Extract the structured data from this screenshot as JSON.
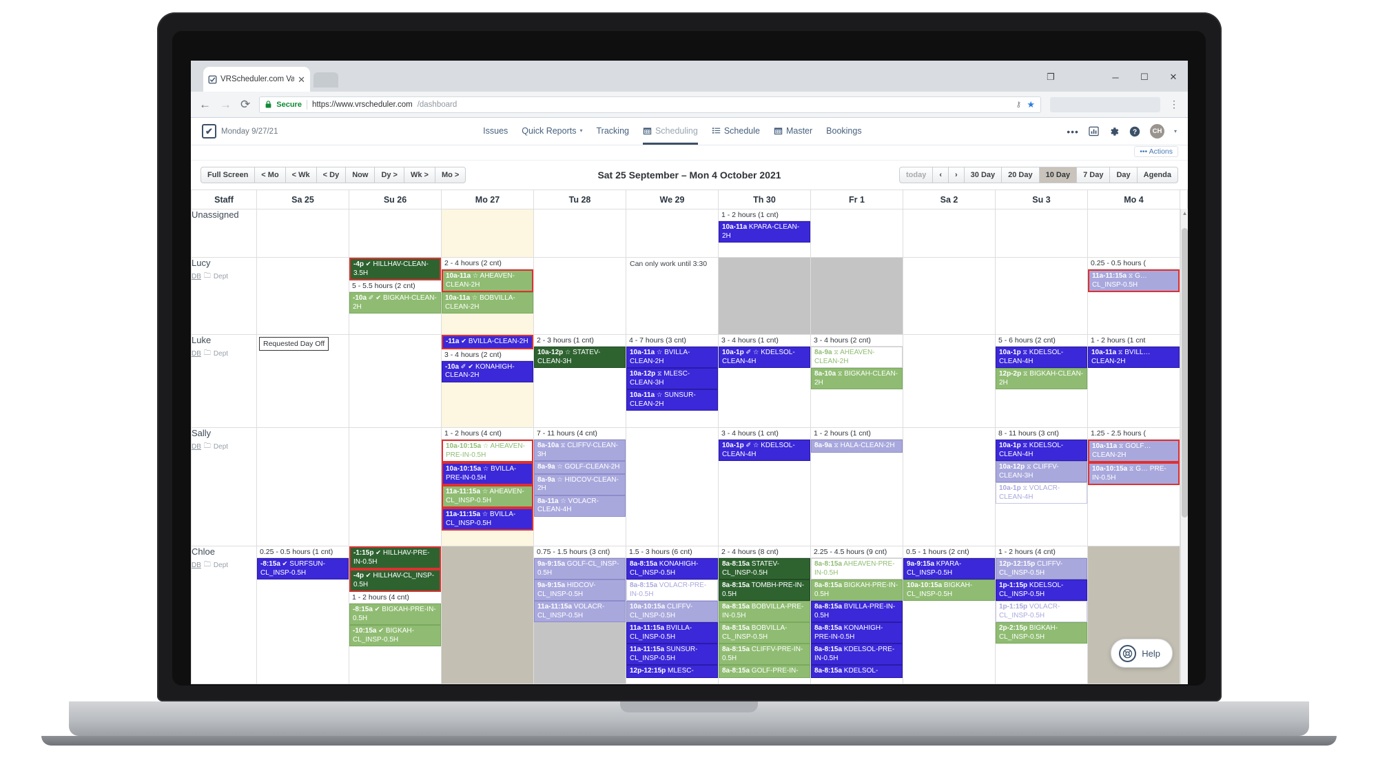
{
  "browser": {
    "tab_title": "VRScheduler.com Vacatio",
    "tab_close": "✕",
    "back": "←",
    "forward": "→",
    "reload": "⟳",
    "secure_label": "Secure",
    "lock_icon": "🔒",
    "url_host": "https://www.vrscheduler.com",
    "url_path": "/dashboard",
    "key_icon": "⚷",
    "star_icon": "★",
    "menu_icon": "⋮",
    "window_minimize": "─",
    "window_maximize": "☐",
    "window_close": "✕",
    "window_restore": "❐"
  },
  "header": {
    "brand_glyph": "✔",
    "brand_date": "Monday  9/27/21",
    "nav": [
      {
        "label": "Issues",
        "icon": "",
        "active": false,
        "caret": false
      },
      {
        "label": "Quick Reports",
        "icon": "",
        "active": false,
        "caret": true
      },
      {
        "label": "Tracking",
        "icon": "",
        "active": false,
        "caret": false
      },
      {
        "label": "Scheduling",
        "icon": "calendar-icon",
        "active": true,
        "caret": false
      },
      {
        "label": "Schedule",
        "icon": "list-icon",
        "active": false,
        "caret": false
      },
      {
        "label": "Master",
        "icon": "calendar-icon",
        "active": false,
        "caret": false
      },
      {
        "label": "Bookings",
        "icon": "",
        "active": false,
        "caret": false
      }
    ],
    "icons": [
      {
        "name": "more-icon",
        "glyph": "•••"
      },
      {
        "name": "chart-icon",
        "glyph": "📊"
      },
      {
        "name": "gear-icon",
        "glyph": "⚙"
      },
      {
        "name": "help-icon",
        "glyph": "?"
      }
    ],
    "avatar_initials": "CH",
    "avatar_caret": "ˇ"
  },
  "actions": {
    "label": "Actions",
    "icon": "•••"
  },
  "toolbar": {
    "left_buttons": [
      "Full Screen",
      "< Mo",
      "< Wk",
      "< Dy",
      "Now",
      "Dy >",
      "Wk >",
      "Mo >"
    ],
    "range_title": "Sat 25 September – Mon 4 October 2021",
    "right_buttons": [
      {
        "label": "today",
        "state": "muted"
      },
      {
        "label": "‹",
        "state": "normal"
      },
      {
        "label": "›",
        "state": "normal"
      },
      {
        "label": "30 Day",
        "state": "normal"
      },
      {
        "label": "20 Day",
        "state": "normal"
      },
      {
        "label": "10 Day",
        "state": "active"
      },
      {
        "label": "7 Day",
        "state": "normal"
      },
      {
        "label": "Day",
        "state": "normal"
      },
      {
        "label": "Agenda",
        "state": "normal"
      }
    ]
  },
  "calendar": {
    "staff_header": "Staff",
    "days": [
      "Sa 25",
      "Su 26",
      "Mo 27",
      "Tu 28",
      "We 29",
      "Th 30",
      "Fr 1",
      "Sa 2",
      "Su 3",
      "Mo 4"
    ],
    "today_index": 2,
    "dept_label": "Dept",
    "db_label": "DB",
    "rows": [
      {
        "staff": "Unassigned",
        "show_meta": false,
        "cells": [
          {},
          {},
          {
            "today": true
          },
          {},
          {},
          {
            "header": "1 - 2 hours (1 cnt)",
            "events": [
              {
                "time": "10a-11a",
                "glyph": "",
                "title": "KPARA-CLEAN-2H",
                "style": "ev-blue"
              }
            ]
          },
          {},
          {},
          {},
          {}
        ]
      },
      {
        "staff": "Lucy",
        "show_meta": true,
        "cells": [
          {},
          {
            "header": "",
            "events": [
              {
                "time": "-4p",
                "glyph": "✔",
                "title": "HILLHAV-CLEAN-3.5H",
                "style": "ev-dgreen",
                "selected": true
              }
            ],
            "header2": "5 - 5.5 hours (2 cnt)",
            "events2": [
              {
                "time": "-10a",
                "glyph": "✐ ✔",
                "title": "BIGKAH-CLEAN-2H",
                "style": "ev-green"
              }
            ]
          },
          {
            "today": true,
            "header": "2 - 4 hours (2 cnt)",
            "events": [
              {
                "time": "10a-11a",
                "glyph": "☆",
                "title": "AHEAVEN-CLEAN-2H",
                "style": "ev-green",
                "selected": true
              },
              {
                "time": "10a-11a",
                "glyph": "☆",
                "title": "BOBVILLA-CLEAN-2H",
                "style": "ev-green"
              }
            ]
          },
          {},
          {
            "note_plain": "Can only work until 3:30"
          },
          {
            "blocked": true
          },
          {
            "blocked": true
          },
          {},
          {},
          {
            "header": "0.25 - 0.5 hours (",
            "events": [
              {
                "time": "11a-11:15a",
                "glyph": "⧖",
                "title": "G… CL_INSP-0.5H",
                "style": "ev-lblue",
                "selected": true
              }
            ]
          }
        ]
      },
      {
        "staff": "Luke",
        "show_meta": true,
        "cells": [
          {
            "note_box": "Requested Day Off"
          },
          {},
          {
            "today": true,
            "events": [
              {
                "time": "-11a",
                "glyph": "✔",
                "title": "BVILLA-CLEAN-2H",
                "style": "ev-blue",
                "selected": true
              }
            ],
            "header2": "3 - 4 hours (2 cnt)",
            "events2": [
              {
                "time": "-10a",
                "glyph": "✐ ✔",
                "title": "KONAHIGH-CLEAN-2H",
                "style": "ev-blue"
              }
            ]
          },
          {
            "header": "2 - 3 hours (1 cnt)",
            "events": [
              {
                "time": "10a-12p",
                "glyph": "☆",
                "title": "STATEV-CLEAN-3H",
                "style": "ev-dgreen"
              }
            ]
          },
          {
            "header": "4 - 7 hours (3 cnt)",
            "events": [
              {
                "time": "10a-11a",
                "glyph": "☆",
                "title": "BVILLA-CLEAN-2H",
                "style": "ev-blue"
              },
              {
                "time": "10a-12p",
                "glyph": "⧖",
                "title": "MLESC-CLEAN-3H",
                "style": "ev-blue"
              },
              {
                "time": "10a-11a",
                "glyph": "☆",
                "title": "SUNSUR-CLEAN-2H",
                "style": "ev-blue"
              }
            ]
          },
          {
            "header": "3 - 4 hours (1 cnt)",
            "events": [
              {
                "time": "10a-1p",
                "glyph": "✐ ☆",
                "title": "KDELSOL-CLEAN-4H",
                "style": "ev-blue"
              }
            ]
          },
          {
            "header": "3 - 4 hours (2 cnt)",
            "events": [
              {
                "time": "8a-9a",
                "glyph": "⧖",
                "title": "AHEAVEN-CLEAN-2H",
                "style": "ev-white-g"
              },
              {
                "time": "8a-10a",
                "glyph": "⧖",
                "title": "BIGKAH-CLEAN-2H",
                "style": "ev-green"
              }
            ]
          },
          {},
          {
            "header": "5 - 6 hours (2 cnt)",
            "events": [
              {
                "time": "10a-1p",
                "glyph": "⧖",
                "title": "KDELSOL-CLEAN-4H",
                "style": "ev-blue"
              },
              {
                "time": "12p-2p",
                "glyph": "⧖",
                "title": "BIGKAH-CLEAN-2H",
                "style": "ev-green"
              }
            ]
          },
          {
            "header": "1 - 2 hours (1 cnt",
            "events": [
              {
                "time": "10a-11a",
                "glyph": "⧖",
                "title": "BVILL… CLEAN-2H",
                "style": "ev-blue"
              }
            ]
          }
        ]
      },
      {
        "staff": "Sally",
        "show_meta": true,
        "cells": [
          {},
          {},
          {
            "today": true,
            "header": "1 - 2 hours (4 cnt)",
            "events": [
              {
                "time": "10a-10:15a",
                "glyph": "☆",
                "title": "AHEAVEN-PRE-IN-0.5H",
                "style": "ev-white-g",
                "selected": true
              },
              {
                "time": "10a-10:15a",
                "glyph": "☆",
                "title": "BVILLA-PRE-IN-0.5H",
                "style": "ev-blue",
                "selected": true
              },
              {
                "time": "11a-11:15a",
                "glyph": "☆",
                "title": "AHEAVEN-CL_INSP-0.5H",
                "style": "ev-green",
                "selected": true
              },
              {
                "time": "11a-11:15a",
                "glyph": "☆",
                "title": "BVILLA-CL_INSP-0.5H",
                "style": "ev-blue",
                "selected": true
              }
            ]
          },
          {
            "header": "7 - 11 hours (4 cnt)",
            "events": [
              {
                "time": "8a-10a",
                "glyph": "⧖",
                "title": "CLIFFV-CLEAN-3H",
                "style": "ev-lblue"
              },
              {
                "time": "8a-9a",
                "glyph": "☆",
                "title": "GOLF-CLEAN-2H",
                "style": "ev-lblue"
              },
              {
                "time": "8a-9a",
                "glyph": "☆",
                "title": "HIDCOV-CLEAN-2H",
                "style": "ev-lblue"
              },
              {
                "time": "8a-11a",
                "glyph": "☆",
                "title": "VOLACR-CLEAN-4H",
                "style": "ev-lblue"
              }
            ]
          },
          {},
          {
            "header": "3 - 4 hours (1 cnt)",
            "events": [
              {
                "time": "10a-1p",
                "glyph": "✐ ☆",
                "title": "KDELSOL-CLEAN-4H",
                "style": "ev-blue"
              }
            ]
          },
          {
            "header": "1 - 2 hours (1 cnt)",
            "events": [
              {
                "time": "8a-9a",
                "glyph": "⧖",
                "title": "HALA-CLEAN-2H",
                "style": "ev-lblue"
              }
            ]
          },
          {},
          {
            "header": "8 - 11 hours (3 cnt)",
            "events": [
              {
                "time": "10a-1p",
                "glyph": "⧖",
                "title": "KDELSOL-CLEAN-4H",
                "style": "ev-blue"
              },
              {
                "time": "10a-12p",
                "glyph": "⧖",
                "title": "CLIFFV-CLEAN-3H",
                "style": "ev-lblue"
              },
              {
                "time": "10a-1p",
                "glyph": "⧖",
                "title": "VOLACR-CLEAN-4H",
                "style": "ev-white-b"
              }
            ]
          },
          {
            "header": "1.25 - 2.5 hours (",
            "events": [
              {
                "time": "10a-11a",
                "glyph": "⧖",
                "title": "GOLF… CLEAN-2H",
                "style": "ev-lblue",
                "selected": true
              },
              {
                "time": "10a-10:15a",
                "glyph": "⧖",
                "title": "G… PRE-IN-0.5H",
                "style": "ev-lblue",
                "selected": true
              }
            ]
          }
        ]
      },
      {
        "staff": "Chloe",
        "show_meta": true,
        "cells": [
          {
            "header": "0.25 - 0.5 hours (1 cnt)",
            "events": [
              {
                "time": "-8:15a",
                "glyph": "✔",
                "title": "SURFSUN-CL_INSP-0.5H",
                "style": "ev-blue"
              }
            ]
          },
          {
            "events": [
              {
                "time": "-1:15p",
                "glyph": "✔",
                "title": "HILLHAV-PRE-IN-0.5H",
                "style": "ev-dgreen",
                "selected": true
              },
              {
                "time": "-4p",
                "glyph": "✔",
                "title": "HILLHAV-CL_INSP-0.5H",
                "style": "ev-dgreen",
                "selected": true
              }
            ],
            "header2": "1 - 2 hours (4 cnt)",
            "events2": [
              {
                "time": "-8:15a",
                "glyph": "✔",
                "title": "BIGKAH-PRE-IN-0.5H",
                "style": "ev-green"
              },
              {
                "time": "-10:15a",
                "glyph": "✔",
                "title": "BIGKAH-CL_INSP-0.5H",
                "style": "ev-green"
              }
            ]
          },
          {
            "today": true,
            "blocked2": true
          },
          {
            "header": "0.75 - 1.5 hours (3 cnt)",
            "blocked": true,
            "events": [
              {
                "time": "9a-9:15a",
                "glyph": "",
                "title": "GOLF-CL_INSP-0.5H",
                "style": "ev-lblue"
              },
              {
                "time": "9a-9:15a",
                "glyph": "",
                "title": "HIDCOV-CL_INSP-0.5H",
                "style": "ev-lblue"
              },
              {
                "time": "11a-11:15a",
                "glyph": "",
                "title": "VOLACR-CL_INSP-0.5H",
                "style": "ev-lblue"
              }
            ]
          },
          {
            "header": "1.5 - 3 hours (6 cnt)",
            "events": [
              {
                "time": "8a-8:15a",
                "glyph": "",
                "title": "KONAHIGH-CL_INSP-0.5H",
                "style": "ev-blue"
              },
              {
                "time": "8a-8:15a",
                "glyph": "",
                "title": "VOLACR-PRE-IN-0.5H",
                "style": "ev-white-b"
              },
              {
                "time": "10a-10:15a",
                "glyph": "",
                "title": "CLIFFV-CL_INSP-0.5H",
                "style": "ev-lblue"
              },
              {
                "time": "11a-11:15a",
                "glyph": "",
                "title": "BVILLA-CL_INSP-0.5H",
                "style": "ev-blue"
              },
              {
                "time": "11a-11:15a",
                "glyph": "",
                "title": "SUNSUR-CL_INSP-0.5H",
                "style": "ev-blue"
              },
              {
                "time": "12p-12:15p",
                "glyph": "",
                "title": "MLESC-",
                "style": "ev-blue"
              }
            ]
          },
          {
            "header": "2 - 4 hours (8 cnt)",
            "events": [
              {
                "time": "8a-8:15a",
                "glyph": "",
                "title": "STATEV-CL_INSP-0.5H",
                "style": "ev-dgreen"
              },
              {
                "time": "8a-8:15a",
                "glyph": "",
                "title": "TOMBH-PRE-IN-0.5H",
                "style": "ev-dgreen"
              },
              {
                "time": "8a-8:15a",
                "glyph": "",
                "title": "BOBVILLA-PRE-IN-0.5H",
                "style": "ev-green"
              },
              {
                "time": "8a-8:15a",
                "glyph": "",
                "title": "BOBVILLA-CL_INSP-0.5H",
                "style": "ev-green"
              },
              {
                "time": "8a-8:15a",
                "glyph": "",
                "title": "CLIFFV-PRE-IN-0.5H",
                "style": "ev-green"
              },
              {
                "time": "8a-8:15a",
                "glyph": "",
                "title": "GOLF-PRE-IN-",
                "style": "ev-green"
              }
            ]
          },
          {
            "header": "2.25 - 4.5 hours (9 cnt)",
            "events": [
              {
                "time": "8a-8:15a",
                "glyph": "",
                "title": "AHEAVEN-PRE-IN-0.5H",
                "style": "ev-white-g"
              },
              {
                "time": "8a-8:15a",
                "glyph": "",
                "title": "BIGKAH-PRE-IN-0.5H",
                "style": "ev-green"
              },
              {
                "time": "8a-8:15a",
                "glyph": "",
                "title": "BVILLA-PRE-IN-0.5H",
                "style": "ev-blue"
              },
              {
                "time": "8a-8:15a",
                "glyph": "",
                "title": "KONAHIGH-PRE-IN-0.5H",
                "style": "ev-blue"
              },
              {
                "time": "8a-8:15a",
                "glyph": "",
                "title": "KDELSOL-PRE-IN-0.5H",
                "style": "ev-blue"
              },
              {
                "time": "8a-8:15a",
                "glyph": "",
                "title": "KDELSOL-",
                "style": "ev-blue"
              }
            ]
          },
          {
            "header": "0.5 - 1 hours (2 cnt)",
            "events": [
              {
                "time": "9a-9:15a",
                "glyph": "",
                "title": "KPARA-CL_INSP-0.5H",
                "style": "ev-blue"
              },
              {
                "time": "10a-10:15a",
                "glyph": "",
                "title": "BIGKAH-CL_INSP-0.5H",
                "style": "ev-green"
              }
            ]
          },
          {
            "header": "1 - 2 hours (4 cnt)",
            "events": [
              {
                "time": "12p-12:15p",
                "glyph": "",
                "title": "CLIFFV-CL_INSP-0.5H",
                "style": "ev-lblue"
              },
              {
                "time": "1p-1:15p",
                "glyph": "",
                "title": "KDELSOL-CL_INSP-0.5H",
                "style": "ev-blue"
              },
              {
                "time": "1p-1:15p",
                "glyph": "",
                "title": "VOLACR-CL_INSP-0.5H",
                "style": "ev-white-b"
              },
              {
                "time": "2p-2:15p",
                "glyph": "",
                "title": "BIGKAH-CL_INSP-0.5H",
                "style": "ev-green"
              }
            ]
          },
          {
            "blocked2": true
          }
        ]
      }
    ]
  },
  "help": {
    "label": "Help",
    "icon": "⌘"
  }
}
